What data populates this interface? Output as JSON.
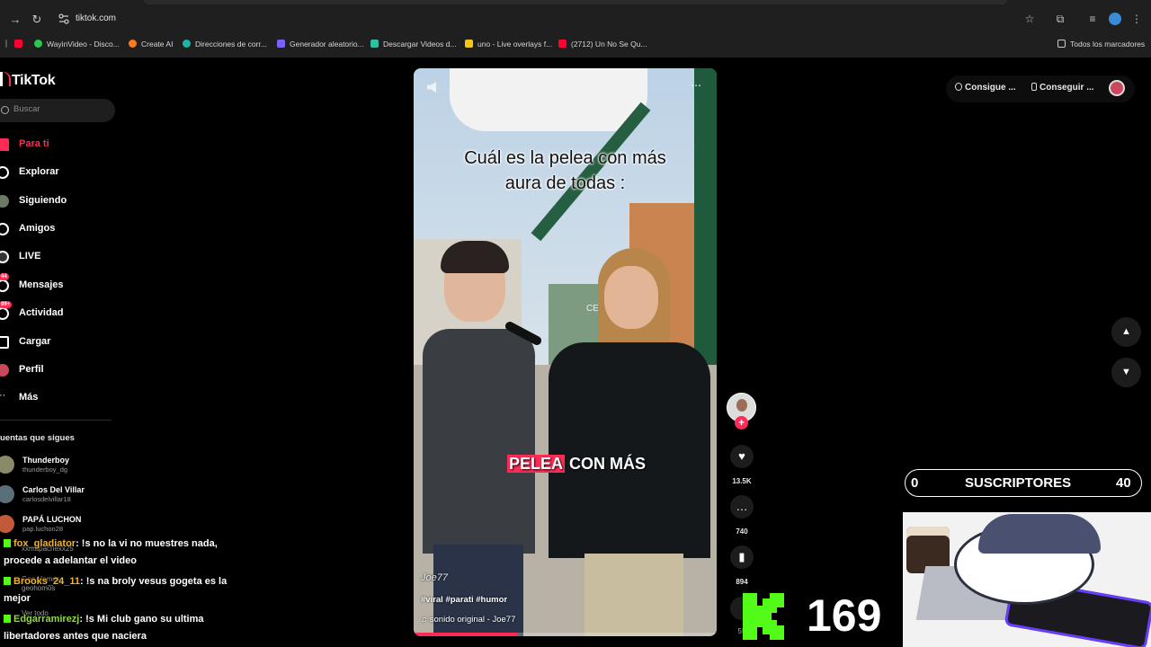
{
  "browser": {
    "url": "tiktok.com",
    "bookmarks": [
      {
        "label": "",
        "color": "#ff0033"
      },
      {
        "label": "WayinVideo - Disco...",
        "color": "#2dc653"
      },
      {
        "label": "Create AI",
        "color": "#ff7a1a"
      },
      {
        "label": "Direcciones de corr...",
        "color": "#21b3a4"
      },
      {
        "label": "Generador aleatorio...",
        "color": "#7b61ff"
      },
      {
        "label": "Descargar Videos d...",
        "color": "#2fbfa3"
      },
      {
        "label": "uno - Live overlays f...",
        "color": "#f5c518"
      },
      {
        "label": "(2712) Un No Se Qu...",
        "color": "#ff0033"
      }
    ],
    "all_bookmarks": "Todos los marcadores"
  },
  "tiktok": {
    "logo": "TikTok",
    "search_placeholder": "Buscar",
    "menu": [
      {
        "label": "Para ti",
        "icon": "home-icon",
        "active": true
      },
      {
        "label": "Explorar",
        "icon": "compass-icon"
      },
      {
        "label": "Siguiendo",
        "icon": "following-icon"
      },
      {
        "label": "Amigos",
        "icon": "friends-icon"
      },
      {
        "label": "LIVE",
        "icon": "live-icon"
      },
      {
        "label": "Mensajes",
        "icon": "messages-icon",
        "badge": "44"
      },
      {
        "label": "Actividad",
        "icon": "activity-icon",
        "badge": "99+"
      },
      {
        "label": "Cargar",
        "icon": "upload-icon"
      },
      {
        "label": "Perfil",
        "icon": "profile-icon"
      },
      {
        "label": "Más",
        "icon": "more-icon"
      }
    ],
    "following_title": "uentas que sigues",
    "following": [
      {
        "name": "Thunderboy",
        "handle": "thunderboy_dg"
      },
      {
        "name": "Carlos Del Villar",
        "handle": "carlosdelvillar18"
      },
      {
        "name": "PAPÁ LUCHON",
        "handle": "pap.luchon28"
      }
    ],
    "ghost_texts": [
      "xxmapachexx25",
      "Geo Homos",
      "geohomos",
      "Ver todo"
    ],
    "top_actions": {
      "get_app": "Consigue ...",
      "get_desktop": "Conseguir ..."
    }
  },
  "video": {
    "caption_line1": "Cuál es la pelea con más",
    "caption_line2": "aura de todas :",
    "sign_text": "CERVECERIA",
    "subtitle_highlight": "PELEA",
    "subtitle_rest": " CON MÁS",
    "author": "Joe77",
    "tags": "#viral #parati #humor",
    "sound": "sonido original - Joe77",
    "progress": 0.34,
    "likes": "13.5K",
    "comments": "740",
    "saves": "894",
    "shares": "55"
  },
  "chat": [
    {
      "user": "fox_gladiator",
      "text": ": !s no la vi no muestres nada, procede a adelantar el video",
      "color": "yellow"
    },
    {
      "user": "Brooks_24_11",
      "text": ": !s na broly vesus gogeta es la mejor",
      "color": "yellow"
    },
    {
      "user": "Edgarramirezj",
      "text": ": !s Mi club gano su ultima libertadores antes que naciera",
      "color": "green"
    }
  ],
  "overlay": {
    "subs_current": "0",
    "subs_label": "SUSCRIPTORES",
    "subs_goal": "40",
    "kick_count": "169"
  }
}
